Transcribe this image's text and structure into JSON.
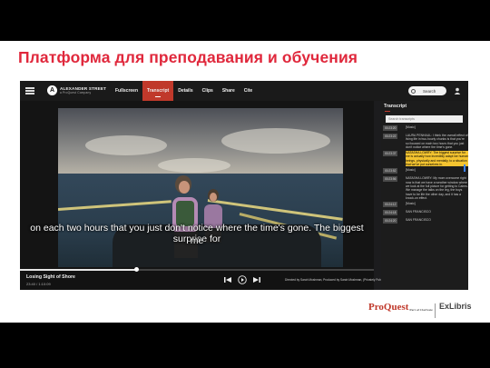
{
  "slide": {
    "title": "Платформа для преподавания и обучения"
  },
  "player": {
    "logo": {
      "name": "ALEXANDER STREET",
      "sub": "a ProQuest Company"
    },
    "tabs": [
      {
        "label": "Fullscreen",
        "active": false
      },
      {
        "label": "Transcript",
        "active": true
      },
      {
        "label": "Details",
        "active": false
      },
      {
        "label": "Clips",
        "active": false
      },
      {
        "label": "Share",
        "active": false
      },
      {
        "label": "Cite",
        "active": false
      }
    ],
    "search_label": "Search",
    "icons": {
      "menu": "hamburger-icon",
      "search": "search-icon",
      "profile": "profile-icon"
    },
    "subtitle_line1": "on each two hours that you just don't notice where the time's gone. The biggest surprise for",
    "subtitle_line2": "me",
    "video_title": "Losing Sight of Shore",
    "video_time": "23:40 / 1:10:09",
    "progress": 0.33,
    "credit": "Directed by Sarah Moshman, Produced by Sarah Moshman, (Privately Published, 2017), 1 hour 10 minutes"
  },
  "transcript": {
    "heading": "Transcript",
    "search_placeholder": "Search transcripts",
    "entries": [
      {
        "time": "00:23:20",
        "text": "[Music]",
        "highlight": false
      },
      {
        "time": "00:23:22",
        "text": "LAURA PENHAUL: I think the overall effect of living life in two-hourly chunks is that you're so focused on each two hours that you just don't notice where the time's gone.",
        "highlight": false
      },
      {
        "time": "00:23:37",
        "text": "NATASHA LOWRY: The biggest surprise for me is actually how incredibly adapt we human beings, physically and mentally, to a situation that we've put ourselves in.",
        "highlight": true
      },
      {
        "time": "00:23:52",
        "text": "[Music]",
        "highlight": false
      },
      {
        "time": "00:23:56",
        "text": "NATASHA LOWRY: My mom overcome right now is that we have a weather window where we look at the full picture for getting to Cairns. We manage the talks on the leg, the boys have to be life the other day, and it has a knock-on effect.",
        "highlight": false
      },
      {
        "time": "00:24:12",
        "text": "[Music]",
        "highlight": false
      },
      {
        "time": "00:24:18",
        "text": "SAN FRANCISCO",
        "highlight": false
      },
      {
        "time": "00:24:20",
        "text": "SAN FRANCISCO",
        "highlight": false
      }
    ]
  },
  "footer": {
    "brand1": "ProQuest",
    "brand1_sub": "Part of Clarivate",
    "brand2": "ExLibris"
  },
  "colors": {
    "accent": "#e0283c",
    "tab_active": "#c0392b",
    "highlight": "#f4c430"
  }
}
